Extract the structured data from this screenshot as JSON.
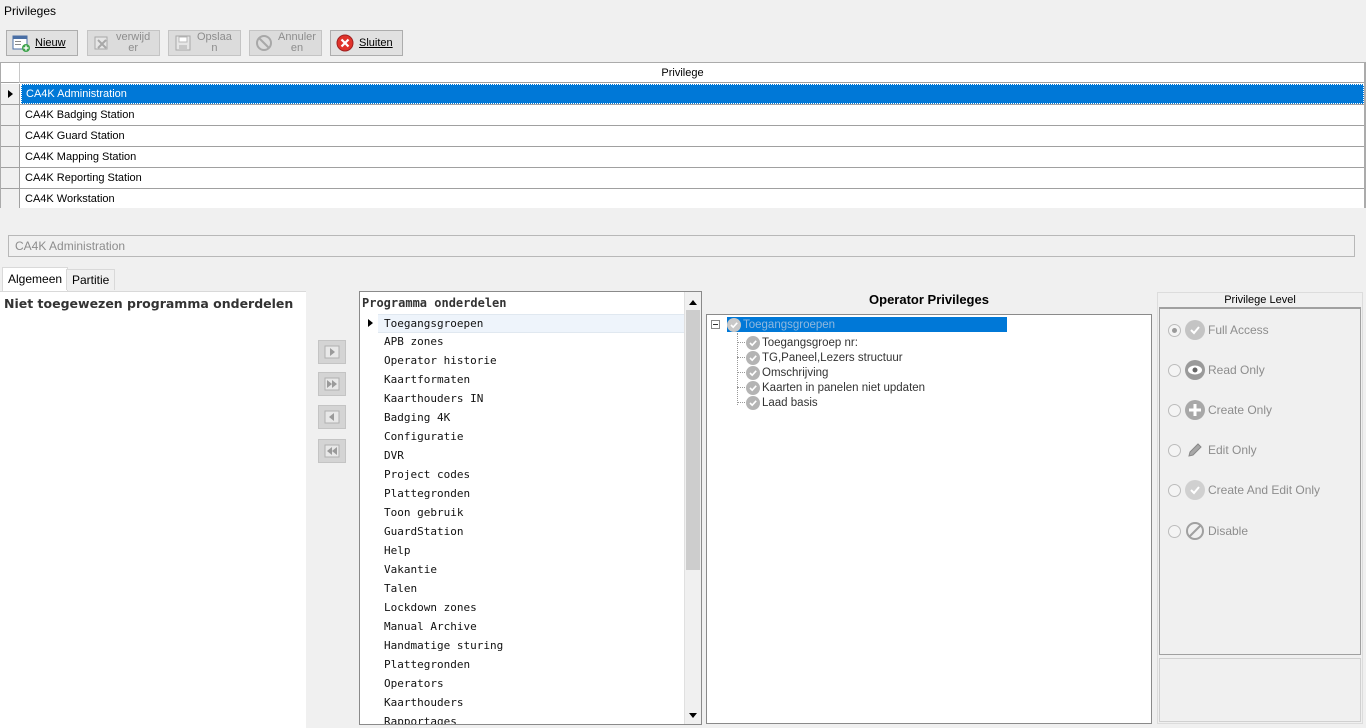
{
  "window": {
    "title": "Privileges"
  },
  "toolbar": {
    "new_label": "Nieuw",
    "delete_label_1": "verwijd",
    "delete_label_2": "er",
    "save_label_1": "Opslaa",
    "save_label_2": "n",
    "cancel_label_1": "Annuler",
    "cancel_label_2": "en",
    "close_label": "Sluiten"
  },
  "grid": {
    "header": "Privilege",
    "rows": [
      "CA4K Administration",
      "CA4K Badging Station",
      "CA4K Guard Station",
      "CA4K Mapping Station",
      "CA4K Reporting Station",
      "CA4K Workstation"
    ],
    "selected_index": 0
  },
  "name_field": {
    "value": "CA4K Administration"
  },
  "tabs": [
    "Algemeen",
    "Partitie"
  ],
  "left_panel": {
    "title": "Niet toegewezen programma onderdelen"
  },
  "middle_panel": {
    "title": "Programma onderdelen",
    "items": [
      "Toegangsgroepen",
      "APB zones",
      "Operator historie",
      "Kaartformaten",
      "Kaarthouders IN",
      "Badging 4K",
      "Configuratie",
      "DVR",
      "Project codes",
      "Plattegronden",
      "Toon gebruik",
      "GuardStation",
      "Help",
      "Vakantie",
      "Talen",
      "Lockdown zones",
      "Manual Archive",
      "Handmatige sturing",
      "Plattegronden",
      "Operators",
      "Kaarthouders",
      "Rapportages"
    ]
  },
  "operator_privileges": {
    "title": "Operator Privileges",
    "root": "Toegangsgroepen",
    "children": [
      "Toegangsgroep nr:",
      "TG,Paneel,Lezers structuur",
      "Omschrijving",
      "Kaarten in panelen niet updaten",
      "Laad basis"
    ]
  },
  "privilege_level": {
    "title": "Privilege Level",
    "options": [
      {
        "label": "Full Access",
        "icon": "check-circle-icon"
      },
      {
        "label": "Read Only",
        "icon": "eye-icon"
      },
      {
        "label": "Create Only",
        "icon": "plus-circle-icon"
      },
      {
        "label": "Edit Only",
        "icon": "pencil-icon"
      },
      {
        "label": "Create And Edit Only",
        "icon": "check-circle-icon"
      },
      {
        "label": "Disable",
        "icon": "no-entry-icon"
      }
    ],
    "selected_index": 0
  },
  "colors": {
    "selection": "#0078d7",
    "background": "#f0f0f0"
  }
}
